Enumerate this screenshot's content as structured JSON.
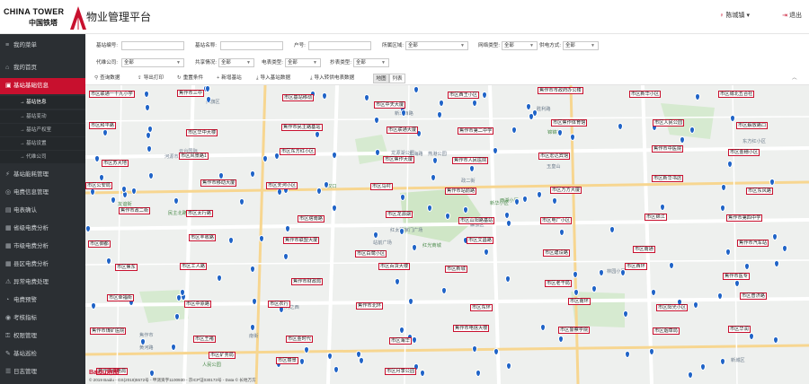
{
  "header": {
    "logo_en": "CHINA TOWER",
    "logo_cn": "中国铁塔",
    "system_title": "物业管理平台",
    "user_name": "陈城镇",
    "logout_label": "退出"
  },
  "colors": {
    "brand": "#c8102e",
    "sidebar": "#2b2f33",
    "marker": "#1f63c7"
  },
  "sidebar": {
    "menu_toggle": "我的菜单",
    "items": [
      {
        "label": "我的首页",
        "icon": "home-icon"
      },
      {
        "label": "基站基础信息",
        "icon": "info-icon",
        "active": true
      },
      {
        "label": "基站能耗管理",
        "icon": "energy-icon"
      },
      {
        "label": "电费信息管理",
        "icon": "money-icon"
      },
      {
        "label": "电表确认",
        "icon": "meter-icon"
      },
      {
        "label": "省级电费分析",
        "icon": "chart-icon"
      },
      {
        "label": "市级电费分析",
        "icon": "chart-icon"
      },
      {
        "label": "县区电费分析",
        "icon": "chart-icon"
      },
      {
        "label": "异常电费处理",
        "icon": "alert-icon"
      },
      {
        "label": "电费预警",
        "icon": "warning-icon"
      },
      {
        "label": "考核指标",
        "icon": "target-icon"
      },
      {
        "label": "权限管理",
        "icon": "lock-icon"
      },
      {
        "label": "基站巡检",
        "icon": "inspect-icon"
      },
      {
        "label": "日志管理",
        "icon": "log-icon"
      }
    ],
    "subitems": [
      {
        "label": "基站信息",
        "current": true
      },
      {
        "label": "基站变动"
      },
      {
        "label": "基站产权室"
      },
      {
        "label": "基站设置"
      },
      {
        "label": "代维公司"
      }
    ]
  },
  "filters": {
    "station_no": {
      "label": "基站编号:",
      "value": ""
    },
    "station_name": {
      "label": "基站名称:",
      "value": ""
    },
    "owner": {
      "label": "户号:",
      "value": ""
    },
    "region": {
      "label": "所属区域:",
      "value": "全部"
    },
    "network": {
      "label": "网络类型:",
      "value": "全部"
    },
    "power": {
      "label": "供电方式:",
      "value": "全部"
    },
    "maintenance": {
      "label": "代维公司:",
      "value": "全部"
    },
    "shared": {
      "label": "共享情况:",
      "value": "全部"
    },
    "meter": {
      "label": "电表类型:",
      "value": "全部"
    },
    "ledger": {
      "label": "抄表类型:",
      "value": "全部"
    }
  },
  "toolbar": {
    "query": "查询数据",
    "export": "导出打印",
    "reset": "重置条件",
    "add": "新增基站",
    "import_station": "导入基站数据",
    "import_transfer": "导入转供电表数据",
    "map_tab": "地图",
    "list_tab": "列表"
  },
  "map": {
    "copyright": "© 2019 Baidu - GS(2018)5572号 - 甲测资字1100930 - 京ICP证030173号 - Data © 长地万方",
    "baidu_logo": "Baidu地图",
    "pois": [
      "红光商城",
      "河源市政府",
      "红太阳家门广场",
      "焦作市",
      "新华小区",
      "黄河之西",
      "胜利路",
      "燕港公园",
      "锦锦苑",
      "解放区",
      "红旗区",
      "新城区",
      "民主北路",
      "东方红小区",
      "站前广场",
      "玉皇山",
      "人民公园",
      "龙源湖公园",
      "政二街",
      "文化街",
      "汉口",
      "黄河路",
      "南街",
      "东海路",
      "西湖小区",
      "林园小区",
      "云台国际",
      "新华西路",
      "友谊街"
    ],
    "labels": [
      "市区联通一十九小学",
      "焦作市三中",
      "市区基站移动",
      "市区中天大厦",
      "市区西王小区",
      "焦作市市政府办公楼",
      "市区新华小区",
      "市区城北五合社",
      "市区和平路",
      "市区华中大楼",
      "焦作市民主路基站",
      "市区联通大厦",
      "焦作市第二中学",
      "市区焦作体育馆",
      "市区人民公园",
      "市区解放路口",
      "市区苏大地",
      "市区风景路1",
      "市区东方红小区",
      "市区焦作大厦",
      "焦作市人民医院",
      "市区宏达宾馆",
      "焦作市中医院",
      "市区金穗小区",
      "市区公安局",
      "焦作市移动大厦",
      "市区天河小区",
      "市区马村",
      "焦作市站前路",
      "市区万方大厦",
      "市区新华书店",
      "市区东风路",
      "焦作市政二街",
      "市区太行路",
      "市区塔南路",
      "市区龙源湖",
      "市区山阳路基站",
      "市区电厂小区",
      "市区锦江",
      "焦作市第四中学",
      "市区御都",
      "市区丰收路",
      "焦作市联盟大厦",
      "市区白鹭小区",
      "市区文昌路",
      "市区建设路",
      "市区南通",
      "焦作市汽车站",
      "市区焦东",
      "市区工人路",
      "焦作市财政局",
      "市区百货大楼",
      "市区新城",
      "市区老干局",
      "市区西环",
      "焦作市医专",
      "市区幸福街",
      "市区中原路",
      "市区农行",
      "焦作市北环",
      "市区东环",
      "市区南环",
      "市区阳光小区",
      "市区普济路",
      "焦作市煤矿医院",
      "市区王褚",
      "市区金时代",
      "市区海华",
      "焦作市电信大楼",
      "市区警察学院",
      "市区烟草局",
      "市区华润",
      "焦作市供电局",
      "市区矿务局",
      "市区丽景",
      "市区月季公园"
    ]
  }
}
